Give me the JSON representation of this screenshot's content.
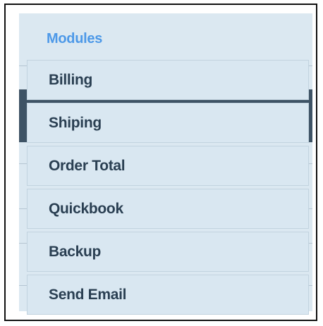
{
  "menu": {
    "title": "Modules",
    "items": [
      {
        "label": "Billing"
      },
      {
        "label": "Shiping"
      },
      {
        "label": "Order Total"
      },
      {
        "label": "Quickbook"
      },
      {
        "label": "Backup"
      },
      {
        "label": "Send Email"
      }
    ]
  },
  "colors": {
    "title_accent": "#4d99e8",
    "item_text": "#2a3f52",
    "item_background": "#d9e7f1",
    "panel_background": "#dbe8f1",
    "dark_bar": "#3e5365"
  }
}
